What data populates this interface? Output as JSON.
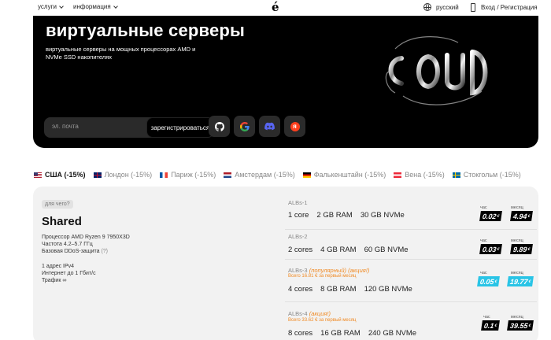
{
  "nav": {
    "services": "услуги",
    "info": "информация",
    "logo": "é",
    "language": "русский",
    "login": "Вход / Регистрация"
  },
  "hero": {
    "title": "виртуальные серверы",
    "subtitle": "виртуальные серверы на мощных процессорах AMD и NVMe SSD накопителях",
    "email_placeholder": "эл. почта",
    "register_label": "зарегистрироваться",
    "social": [
      "github-icon",
      "google-icon",
      "discord-icon",
      "yandex-icon"
    ],
    "yandex_letter": "я"
  },
  "locations": [
    {
      "label": "США (-15%)",
      "active": true
    },
    {
      "label": "Лондон (-15%)",
      "active": false
    },
    {
      "label": "Париж (-15%)",
      "active": false
    },
    {
      "label": "Амстердам (-15%)",
      "active": false
    },
    {
      "label": "Фалькенштайн (-15%)",
      "active": false
    },
    {
      "label": "Вена (-15%)",
      "active": false
    },
    {
      "label": "Стокгольм (-15%)",
      "active": false
    }
  ],
  "plan": {
    "tag": "для чего?",
    "name": "Shared",
    "cpu": "Процессор AMD Ryzen 9 7950X3D",
    "freq": "Частота 4.2–5.7 ГГц",
    "ddos": "Базовая DDoS-защита",
    "ddos_hint": "(?)",
    "ip": "1 адрес IPv4",
    "net": "Интернет до 1 Гбит/с",
    "traffic": "Трафик ∞"
  },
  "price_labels": {
    "hour": "час",
    "month": "месяц"
  },
  "tiers": [
    {
      "name": "ALBs-1",
      "extra": "",
      "promo": "",
      "cores": "1 core",
      "ram": "2 GB RAM",
      "disk": "30 GB NVMe",
      "hour": "0.02",
      "month": "4.94",
      "currency": "€",
      "hour_cyan": false,
      "month_cyan": false
    },
    {
      "name": "ALBs-2",
      "extra": "",
      "promo": "",
      "cores": "2 cores",
      "ram": "4 GB RAM",
      "disk": "60 GB NVMe",
      "hour": "0.03",
      "month": "9.89",
      "currency": "€",
      "hour_cyan": false,
      "month_cyan": false
    },
    {
      "name": "ALBs-3",
      "extra": "(популярный) (акция!)",
      "promo": "Всего 16.81 € за первый месяц",
      "cores": "4 cores",
      "ram": "8 GB RAM",
      "disk": "120 GB NVMe",
      "hour": "0.05",
      "month": "19.77",
      "currency": "€",
      "hour_cyan": true,
      "month_cyan": true
    },
    {
      "name": "ALBs-4",
      "extra": "(акция!)",
      "promo": "Всего 33.62 € за первый месяц",
      "cores": "8 cores",
      "ram": "16 GB RAM",
      "disk": "240 GB NVMe",
      "hour": "0.1",
      "month": "39.55",
      "currency": "€",
      "hour_cyan": false,
      "month_cyan": false
    }
  ]
}
